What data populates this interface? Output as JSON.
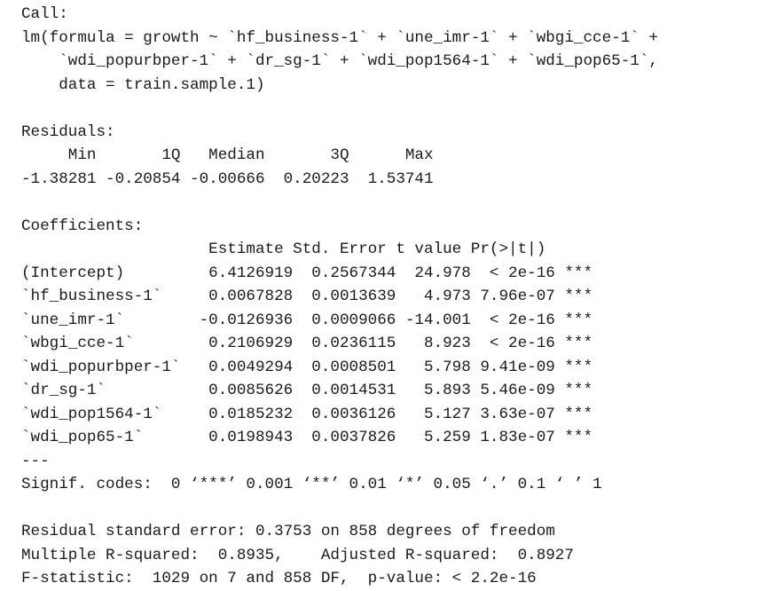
{
  "output": {
    "lines": [
      "Call:",
      "lm(formula = growth ~ `hf_business-1` + `une_imr-1` + `wbgi_cce-1` +",
      "    `wdi_popurbper-1` + `dr_sg-1` + `wdi_pop1564-1` + `wdi_pop65-1`,",
      "    data = train.sample.1)",
      "",
      "Residuals:",
      "     Min       1Q   Median       3Q      Max ",
      "-1.38281 -0.20854 -0.00666  0.20223  1.53741 ",
      "",
      "Coefficients:",
      "                    Estimate Std. Error t value Pr(>|t|)    ",
      "(Intercept)         6.4126919  0.2567344  24.978  < 2e-16 ***",
      "`hf_business-1`     0.0067828  0.0013639   4.973 7.96e-07 ***",
      "`une_imr-1`        -0.0126936  0.0009066 -14.001  < 2e-16 ***",
      "`wbgi_cce-1`        0.2106929  0.0236115   8.923  < 2e-16 ***",
      "`wdi_popurbper-1`   0.0049294  0.0008501   5.798 9.41e-09 ***",
      "`dr_sg-1`           0.0085626  0.0014531   5.893 5.46e-09 ***",
      "`wdi_pop1564-1`     0.0185232  0.0036126   5.127 3.63e-07 ***",
      "`wdi_pop65-1`       0.0198943  0.0037826   5.259 1.83e-07 ***",
      "---",
      "Signif. codes:  0 ‘***’ 0.001 ‘**’ 0.01 ‘*’ 0.05 ‘.’ 0.1 ‘ ’ 1",
      "",
      "Residual standard error: 0.3753 on 858 degrees of freedom",
      "Multiple R-squared:  0.8935,\tAdjusted R-squared:  0.8927 ",
      "F-statistic:  1029 on 7 and 858 DF,  p-value: < 2.2e-16"
    ]
  }
}
